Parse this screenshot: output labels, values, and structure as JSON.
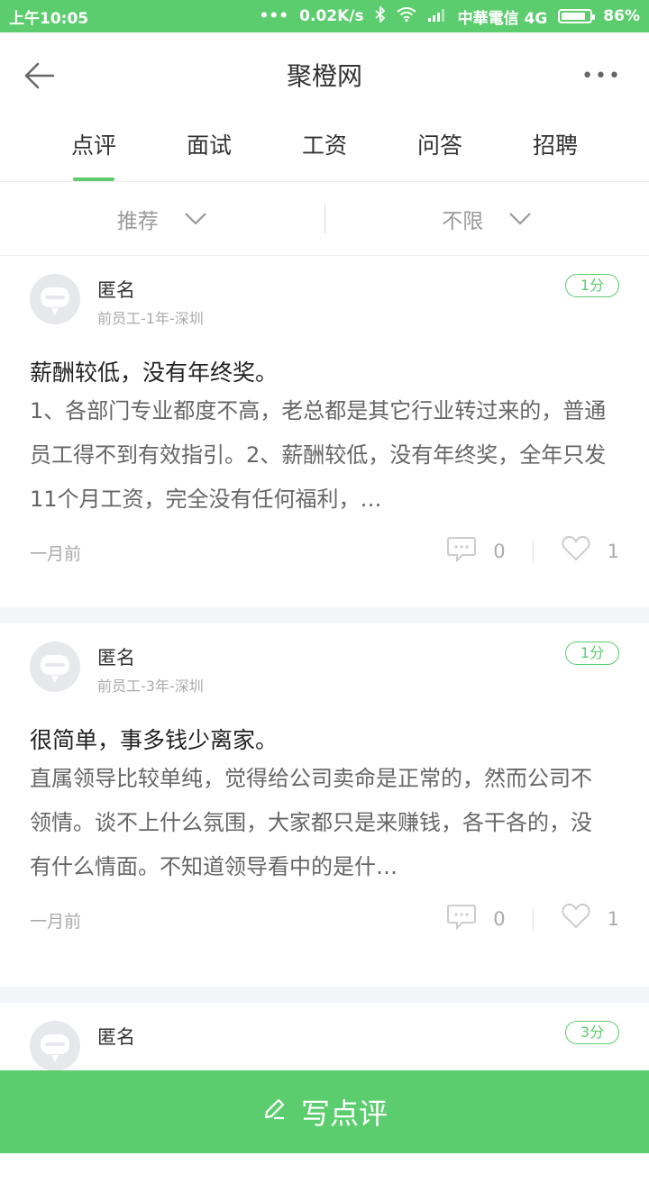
{
  "status": {
    "time": "上午10:05",
    "dots": "•••",
    "speed": "0.02K/s",
    "carrier": "中華電信 4G",
    "battery": "86%"
  },
  "header": {
    "title": "聚橙网",
    "more": "•••"
  },
  "tabs": [
    {
      "label": "点评"
    },
    {
      "label": "面试"
    },
    {
      "label": "工资"
    },
    {
      "label": "问答"
    },
    {
      "label": "招聘"
    }
  ],
  "filters": [
    {
      "label": "推荐"
    },
    {
      "label": "不限"
    }
  ],
  "reviews": [
    {
      "name": "匿名",
      "meta": "前员工-1年-深圳",
      "score": "1分",
      "headline": "薪酬较低，没有年终奖。",
      "body": "1、各部门专业都度不高，老总都是其它行业转过来的，普通员工得不到有效指引。2、薪酬较低，没有年终奖，全年只发11个月工资，完全没有任何福利，…",
      "time": "一月前",
      "comments": "0",
      "likes": "1"
    },
    {
      "name": "匿名",
      "meta": "前员工-3年-深圳",
      "score": "1分",
      "headline": "很简单，事多钱少离家。",
      "body": "直属领导比较单纯，觉得给公司卖命是正常的，然而公司不领情。谈不上什么氛围，大家都只是来赚钱，各干各的，没有什么情面。不知道领导看中的是什…",
      "time": "一月前",
      "comments": "0",
      "likes": "1"
    },
    {
      "name": "匿名",
      "score": "3分"
    }
  ],
  "write_button": "写点评",
  "colors": {
    "accent": "#5ccd6e"
  }
}
